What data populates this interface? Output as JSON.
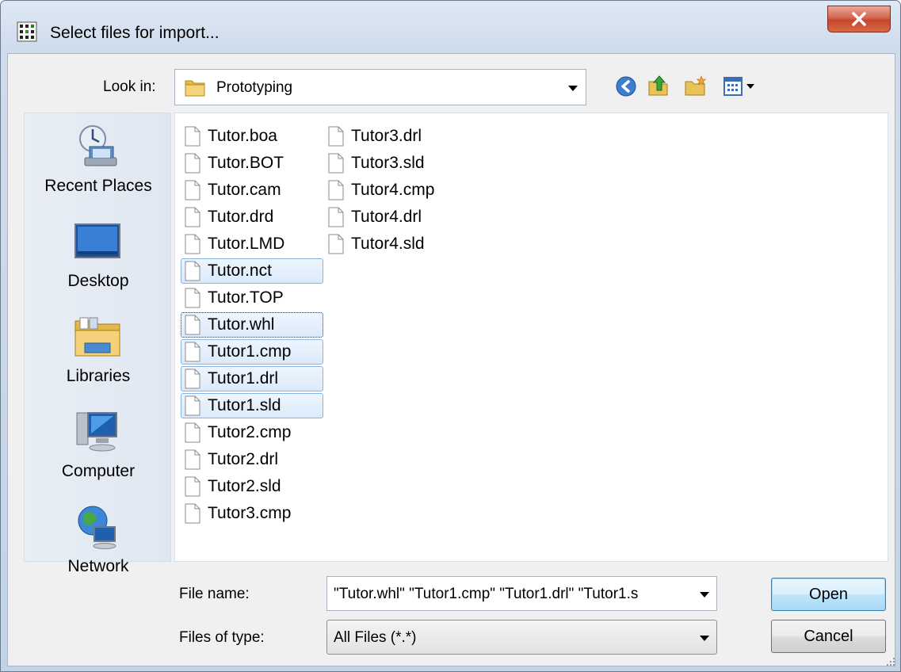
{
  "window": {
    "title": "Select files for import..."
  },
  "toolbar": {
    "look_in_label": "Look in:",
    "look_in_value": "Prototyping",
    "back_icon": "back-arrow-icon",
    "up_icon": "up-folder-icon",
    "new_folder_icon": "new-folder-icon",
    "view_icon": "view-menu-icon"
  },
  "places": [
    {
      "label": "Recent Places",
      "icon": "recent-places-icon"
    },
    {
      "label": "Desktop",
      "icon": "desktop-icon"
    },
    {
      "label": "Libraries",
      "icon": "libraries-icon"
    },
    {
      "label": "Computer",
      "icon": "computer-icon"
    },
    {
      "label": "Network",
      "icon": "network-icon"
    }
  ],
  "files": {
    "col1": [
      {
        "name": "Tutor.boa",
        "state": ""
      },
      {
        "name": "Tutor.BOT",
        "state": ""
      },
      {
        "name": "Tutor.cam",
        "state": ""
      },
      {
        "name": "Tutor.drd",
        "state": ""
      },
      {
        "name": "Tutor.LMD",
        "state": ""
      },
      {
        "name": "Tutor.nct",
        "state": "selected"
      },
      {
        "name": "Tutor.TOP",
        "state": ""
      },
      {
        "name": "Tutor.whl",
        "state": "focused"
      },
      {
        "name": "Tutor1.cmp",
        "state": "selected"
      },
      {
        "name": "Tutor1.drl",
        "state": "selected"
      },
      {
        "name": "Tutor1.sld",
        "state": "selected"
      },
      {
        "name": "Tutor2.cmp",
        "state": ""
      },
      {
        "name": "Tutor2.drl",
        "state": ""
      },
      {
        "name": "Tutor2.sld",
        "state": ""
      },
      {
        "name": "Tutor3.cmp",
        "state": ""
      }
    ],
    "col2": [
      {
        "name": "Tutor3.drl",
        "state": ""
      },
      {
        "name": "Tutor3.sld",
        "state": ""
      },
      {
        "name": "Tutor4.cmp",
        "state": ""
      },
      {
        "name": "Tutor4.drl",
        "state": ""
      },
      {
        "name": "Tutor4.sld",
        "state": ""
      }
    ]
  },
  "footer": {
    "file_name_label": "File name:",
    "file_name_value": "\"Tutor.whl\" \"Tutor1.cmp\" \"Tutor1.drl\" \"Tutor1.s",
    "file_type_label": "Files of type:",
    "file_type_value": "All Files (*.*)",
    "open_label": "Open",
    "cancel_label": "Cancel"
  }
}
